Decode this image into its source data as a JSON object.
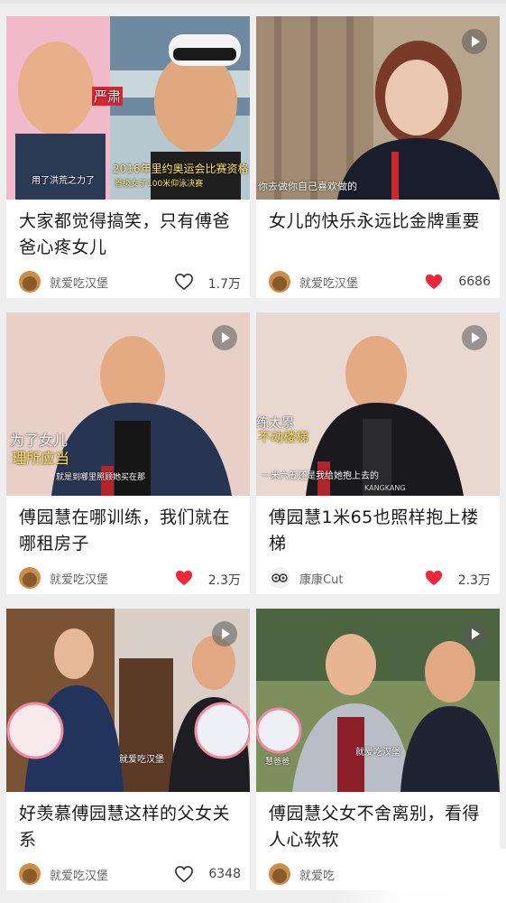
{
  "cards": [
    {
      "title": "大家都觉得搞笑，只有傅爸爸心疼女儿",
      "author": "就爱吃汉堡",
      "likes": "1.7万",
      "liked": false,
      "overlay": [
        "严肃",
        "用了洪荒之力了",
        "2016年里约奥运会比赛资格",
        "首级女子100米仰泳决赛"
      ]
    },
    {
      "title": "女儿的快乐永远比金牌重要",
      "author": "就爱吃汉堡",
      "likes": "6686",
      "liked": true,
      "overlay": [
        "你去做你自己喜欢做的"
      ]
    },
    {
      "title": "傅园慧在哪训练，我们就在哪租房子",
      "author": "就爱吃汉堡",
      "likes": "2.3万",
      "liked": true,
      "overlay": [
        "为了女儿",
        "理所应当",
        "就是到哪里照顾她买在那"
      ]
    },
    {
      "title": "傅园慧1米65也照样抱上楼梯",
      "author": "康康Cut",
      "likes": "2.3万",
      "liked": true,
      "overlay": [
        "练太累",
        "不动楼梯",
        "一米六五还是我给她抱上去的",
        "KANGKANG"
      ]
    },
    {
      "title": "好羡慕傅园慧这样的父女关系",
      "author": "就爱吃汉堡",
      "likes": "6348",
      "liked": false,
      "overlay": [
        "就爱吃汉堡"
      ]
    },
    {
      "title": "傅园慧父女不舍离别，看得人心软软",
      "author": "就爱吃",
      "likes": "",
      "liked": false,
      "overlay": [
        "就爱吃汉堡",
        "慧爸爸"
      ]
    }
  ],
  "colors": {
    "liked_heart": "#f0263f",
    "unliked_heart": "#333333"
  }
}
